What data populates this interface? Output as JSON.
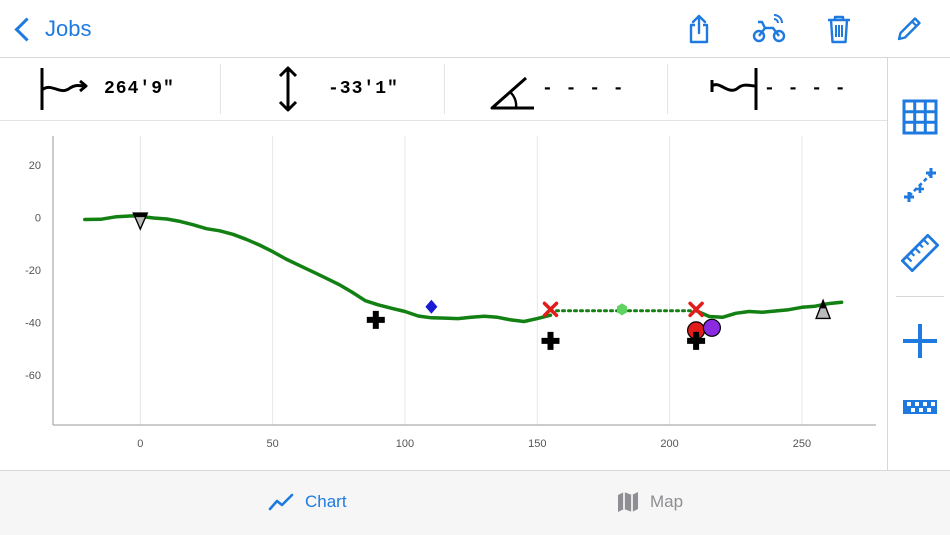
{
  "nav": {
    "back_label": "Jobs"
  },
  "toolbar": {
    "share_icon": "share-icon",
    "bike_signal_icon": "motorbike-signal-icon",
    "trash_icon": "trash-icon",
    "pencil_icon": "pencil-icon"
  },
  "stats": {
    "distance": "264'9\"",
    "elevation": "-33'1\"",
    "angle": "- - - -",
    "span": "- - - -"
  },
  "sidebar": {
    "items": [
      "grid-icon",
      "distance-markers-icon",
      "ruler-icon",
      "add-icon",
      "checkered-flag-icon"
    ]
  },
  "tabs": [
    {
      "label": "Chart",
      "active": true
    },
    {
      "label": "Map",
      "active": false
    }
  ],
  "colors": {
    "accent": "#1f7ae0",
    "profile": "#128012",
    "inactive": "#8e8e93"
  },
  "chart_data": {
    "type": "line",
    "xlim": [
      -33,
      278
    ],
    "ylim": [
      -79,
      31
    ],
    "x_ticks": [
      0,
      50,
      100,
      150,
      200,
      250
    ],
    "y_ticks": [
      20,
      0,
      -20,
      -40,
      -60
    ],
    "grid": "vertical",
    "series": [
      {
        "style": "solid",
        "color": "#128012",
        "x": [
          -21,
          -15,
          -9,
          -3,
          0,
          5,
          10,
          15,
          20,
          25,
          30,
          35,
          40,
          45,
          50,
          55,
          60,
          65,
          70,
          75,
          80,
          85,
          90,
          95,
          100,
          105,
          110,
          115,
          120,
          125,
          130,
          135,
          140,
          145,
          150,
          155
        ],
        "y": [
          -0.8,
          -0.7,
          0.3,
          0.6,
          0.4,
          -0.2,
          -0.6,
          -1.5,
          -2.8,
          -4.3,
          -5.1,
          -6.4,
          -8.3,
          -10.5,
          -13.0,
          -15.8,
          -18.2,
          -20.6,
          -23.0,
          -25.5,
          -28.4,
          -31.7,
          -33.3,
          -34.6,
          -35.8,
          -37.5,
          -38.2,
          -38.3,
          -38.5,
          -38.0,
          -37.6,
          -38.0,
          -39.0,
          -39.6,
          -38.5,
          -37.2
        ]
      },
      {
        "style": "dotted",
        "color": "#128012",
        "x": [
          155,
          210
        ],
        "y": [
          -35.5,
          -35.5
        ]
      },
      {
        "style": "solid",
        "color": "#128012",
        "x": [
          210,
          215,
          220,
          225,
          230,
          235,
          240,
          245,
          250,
          255,
          260,
          265
        ],
        "y": [
          -35.5,
          -37.7,
          -38.0,
          -36.5,
          -35.8,
          -36.1,
          -35.6,
          -35.1,
          -34.2,
          -33.8,
          -32.8,
          -32.3
        ]
      }
    ],
    "markers": [
      {
        "shape": "triangle-down",
        "x": 0,
        "y": -1,
        "color": "#777777"
      },
      {
        "shape": "cross",
        "x": 89,
        "y": -39,
        "color": "#000000"
      },
      {
        "shape": "diamond",
        "x": 110,
        "y": -34,
        "color": "#1a1ad6"
      },
      {
        "shape": "x",
        "x": 155,
        "y": -35,
        "color": "#e21b1b"
      },
      {
        "shape": "cross",
        "x": 155,
        "y": -47,
        "color": "#000000"
      },
      {
        "shape": "hexagon",
        "x": 182,
        "y": -35,
        "color": "#5fd35f"
      },
      {
        "shape": "x",
        "x": 210,
        "y": -35,
        "color": "#e21b1b"
      },
      {
        "shape": "circle",
        "x": 210,
        "y": -43,
        "color": "#e21b1b"
      },
      {
        "shape": "cross",
        "x": 210,
        "y": -47,
        "color": "#000000"
      },
      {
        "shape": "circle",
        "x": 216,
        "y": -42,
        "color": "#8a2be2"
      },
      {
        "shape": "triangle-up",
        "x": 258,
        "y": -35,
        "color": "#777777"
      }
    ]
  }
}
